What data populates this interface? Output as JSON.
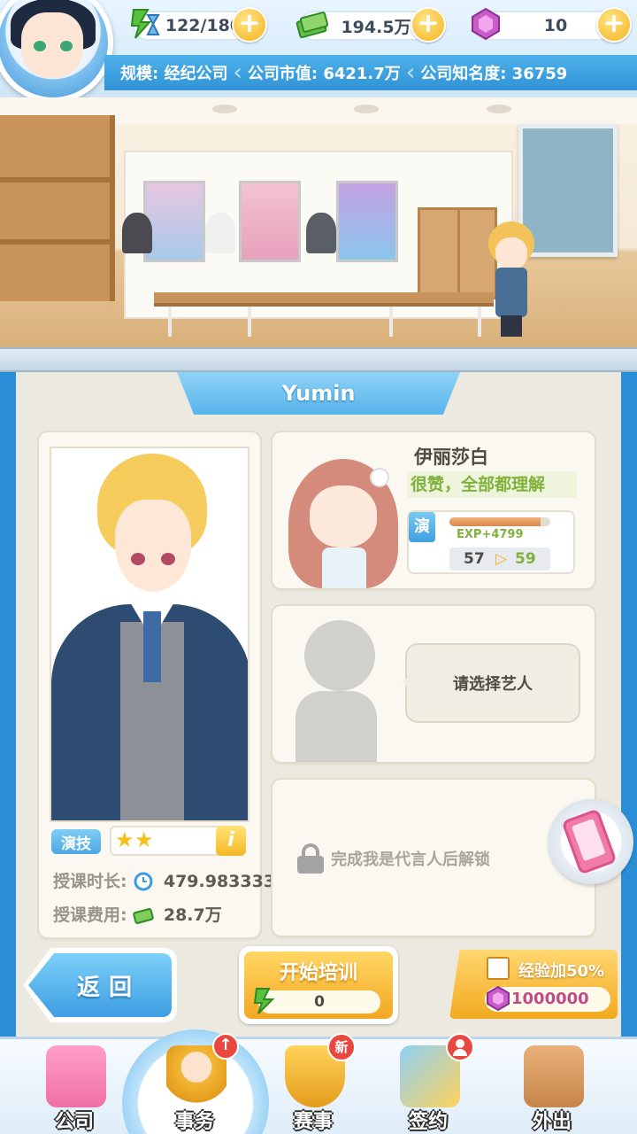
{
  "hud": {
    "stamina": "122/180",
    "money": "194.5万",
    "gems": "10",
    "plus_label": "+",
    "scale": "规模: 经纪公司",
    "market_value": "公司市值: 6421.7万",
    "fame": "公司知名度: 36759"
  },
  "panel": {
    "title": "Yumin"
  },
  "trainee": {
    "skill_label": "演技",
    "stars": 2,
    "info_label": "i",
    "lesson_duration_label": "授课时长:",
    "lesson_duration_value": "479.983333",
    "lesson_fee_label": "授课费用:",
    "lesson_fee_value": "28.7万"
  },
  "teacher": {
    "name": "伊丽莎白",
    "praise": "很赞，全部都理解",
    "skill_tag": "演",
    "exp_gain": "EXP+4799",
    "exp_progress": 0.9,
    "level_from": "57",
    "level_arrow": "▷",
    "level_to": "59"
  },
  "slot2": {
    "prompt": "请选择艺人"
  },
  "slot3": {
    "locked_text": "完成我是代言人后解锁"
  },
  "actions": {
    "back_label": "返回",
    "train_label": "开始培训",
    "train_cost": "0",
    "boost_label": "经验加50%",
    "boost_price": "1000000",
    "boost_checked": false
  },
  "nav": {
    "items": [
      {
        "label": "公司"
      },
      {
        "label": "事务"
      },
      {
        "label": "赛事"
      },
      {
        "label": "签约"
      },
      {
        "label": "外出"
      }
    ],
    "badge_new": "新",
    "badge_up": "↑"
  },
  "colors": {
    "accent_blue": "#3d9ee3",
    "accent_gold": "#f3a722",
    "success_green": "#7fb23a"
  }
}
